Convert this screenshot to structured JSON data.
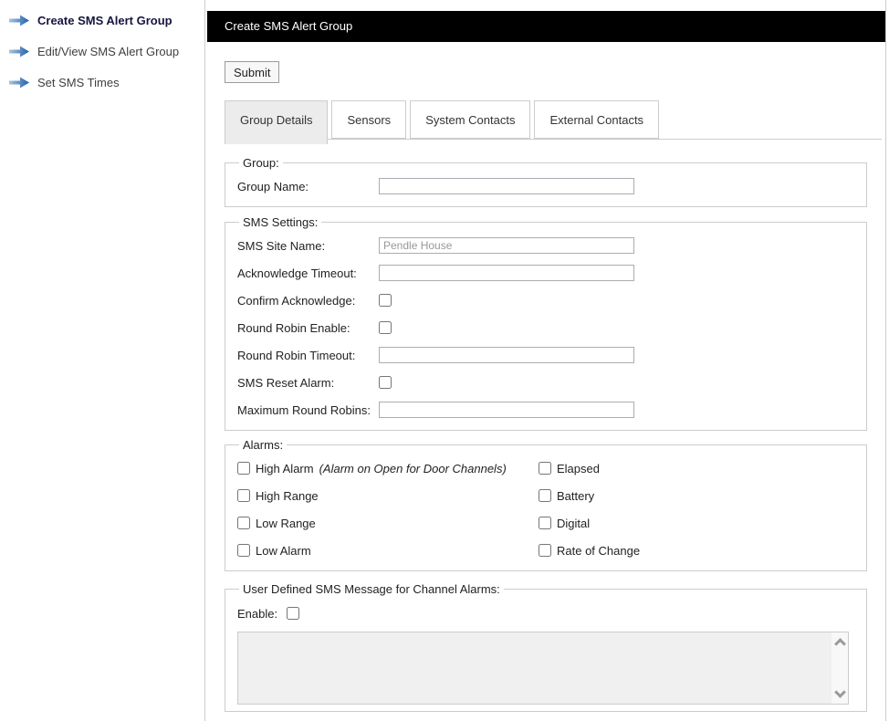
{
  "colors": {
    "titlebar_bg": "#000000",
    "titlebar_text": "#ffffff",
    "arrow_gradient_start": "#a9c4de",
    "arrow_gradient_end": "#1f5fa9",
    "active_tab_bg": "#ececec",
    "disabled_textarea_bg": "#f0f0f0",
    "border": "#cccccc"
  },
  "sidebar": {
    "items": [
      {
        "label": "Create SMS Alert Group",
        "active": true
      },
      {
        "label": "Edit/View SMS Alert Group",
        "active": false
      },
      {
        "label": "Set SMS Times",
        "active": false
      }
    ]
  },
  "header": {
    "title": "Create SMS Alert Group"
  },
  "toolbar": {
    "submit_label": "Submit"
  },
  "tabs": [
    {
      "label": "Group Details",
      "active": true
    },
    {
      "label": "Sensors",
      "active": false
    },
    {
      "label": "System Contacts",
      "active": false
    },
    {
      "label": "External Contacts",
      "active": false
    }
  ],
  "group_section": {
    "legend": "Group:",
    "group_name": {
      "label": "Group Name:",
      "value": ""
    }
  },
  "sms_settings": {
    "legend": "SMS Settings:",
    "site_name": {
      "label": "SMS Site Name:",
      "value": "Pendle House"
    },
    "ack_timeout": {
      "label": "Acknowledge Timeout:",
      "value": ""
    },
    "confirm_ack": {
      "label": "Confirm Acknowledge:",
      "checked": false
    },
    "rr_enable": {
      "label": "Round Robin Enable:",
      "checked": false
    },
    "rr_timeout": {
      "label": "Round Robin Timeout:",
      "value": ""
    },
    "sms_reset": {
      "label": "SMS Reset Alarm:",
      "checked": false
    },
    "max_rr": {
      "label": "Maximum Round Robins:",
      "value": ""
    }
  },
  "alarms": {
    "legend": "Alarms:",
    "left": [
      {
        "label": "High Alarm",
        "note": "(Alarm on Open for Door Channels)"
      },
      {
        "label": "High Range",
        "note": ""
      },
      {
        "label": "Low Range",
        "note": ""
      },
      {
        "label": "Low Alarm",
        "note": ""
      }
    ],
    "right": [
      {
        "label": "Elapsed"
      },
      {
        "label": "Battery"
      },
      {
        "label": "Digital"
      },
      {
        "label": "Rate of Change"
      }
    ]
  },
  "user_message": {
    "legend": "User Defined SMS Message for Channel Alarms:",
    "enable_label": "Enable:",
    "textarea_value": ""
  }
}
